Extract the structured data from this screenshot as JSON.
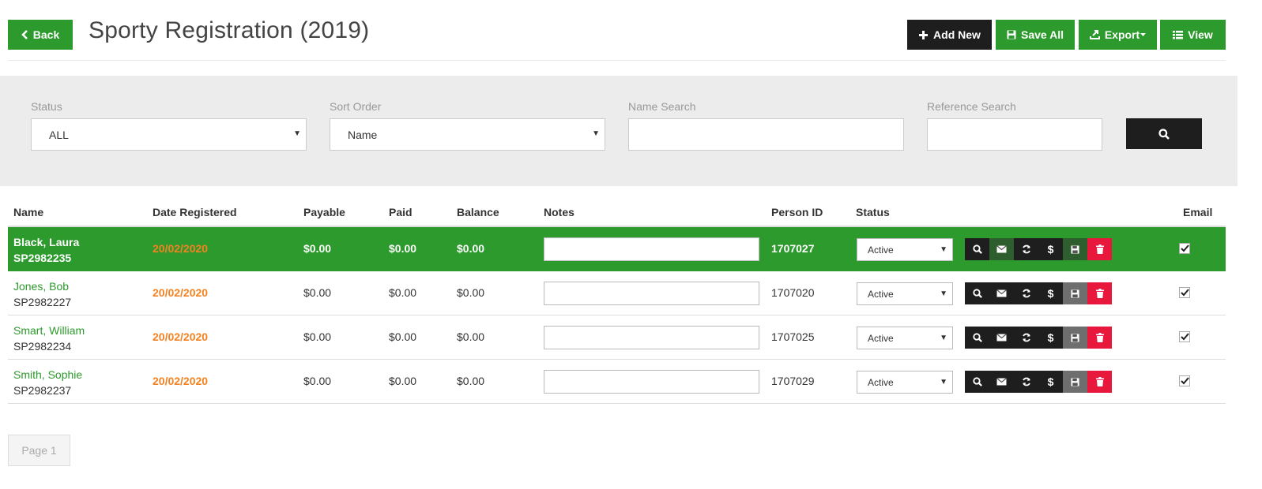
{
  "header": {
    "back_label": "Back",
    "title": "Sporty Registration (2019)",
    "add_new_label": "Add New",
    "save_all_label": "Save All",
    "export_label": "Export",
    "view_label": "View"
  },
  "filters": {
    "status_label": "Status",
    "status_value": "ALL",
    "sort_label": "Sort Order",
    "sort_value": "Name",
    "name_search_label": "Name Search",
    "name_search_value": "",
    "reference_search_label": "Reference Search",
    "reference_search_value": ""
  },
  "table": {
    "columns": [
      "Name",
      "Date Registered",
      "Payable",
      "Paid",
      "Balance",
      "Notes",
      "Person ID",
      "Status",
      "Email"
    ],
    "rows": [
      {
        "name": "Black, Laura",
        "ref": "SP2982235",
        "date": "20/02/2020",
        "payable": "$0.00",
        "paid": "$0.00",
        "balance": "$0.00",
        "notes": "",
        "person_id": "1707027",
        "status": "Active",
        "email_checked": true,
        "selected": true
      },
      {
        "name": "Jones, Bob",
        "ref": "SP2982227",
        "date": "20/02/2020",
        "payable": "$0.00",
        "paid": "$0.00",
        "balance": "$0.00",
        "notes": "",
        "person_id": "1707020",
        "status": "Active",
        "email_checked": true,
        "selected": false
      },
      {
        "name": "Smart, William",
        "ref": "SP2982234",
        "date": "20/02/2020",
        "payable": "$0.00",
        "paid": "$0.00",
        "balance": "$0.00",
        "notes": "",
        "person_id": "1707025",
        "status": "Active",
        "email_checked": true,
        "selected": false
      },
      {
        "name": "Smith, Sophie",
        "ref": "SP2982237",
        "date": "20/02/2020",
        "payable": "$0.00",
        "paid": "$0.00",
        "balance": "$0.00",
        "notes": "",
        "person_id": "1707029",
        "status": "Active",
        "email_checked": true,
        "selected": false
      }
    ],
    "row_actions": [
      "search-icon",
      "envelope-icon",
      "refresh-icon",
      "dollar-icon",
      "save-icon",
      "trash-icon"
    ]
  },
  "pager": {
    "label": "Page 1"
  },
  "colors": {
    "brand_green": "#2c9a2c",
    "dark": "#1e1e1e",
    "date_orange": "#f58220",
    "delete_red": "#e8173c",
    "panel_gray": "#ececec"
  }
}
